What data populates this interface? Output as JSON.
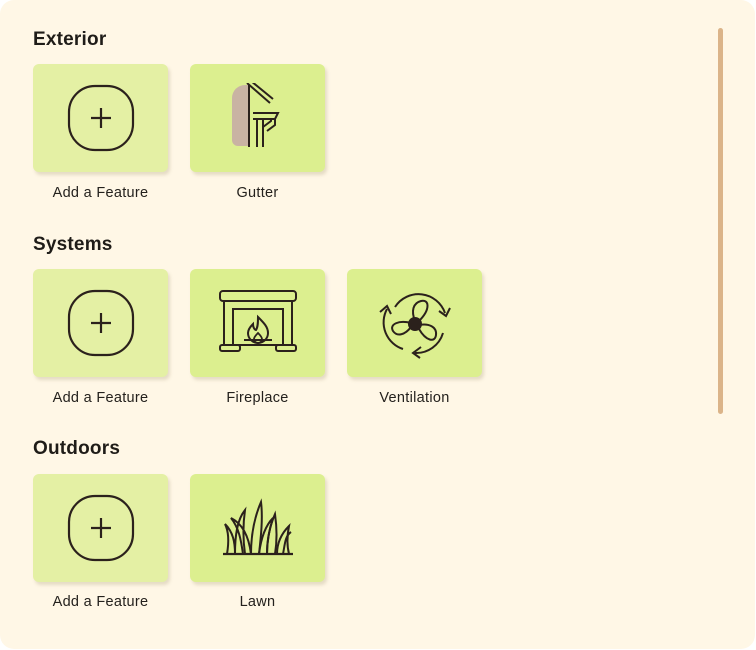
{
  "sections": [
    {
      "title": "Exterior",
      "tiles": [
        {
          "label": "Add a Feature",
          "icon": "plus-circle-icon"
        },
        {
          "label": "Gutter",
          "icon": "gutter-icon"
        }
      ]
    },
    {
      "title": "Systems",
      "tiles": [
        {
          "label": "Add a Feature",
          "icon": "plus-circle-icon"
        },
        {
          "label": "Fireplace",
          "icon": "fireplace-icon"
        },
        {
          "label": "Ventilation",
          "icon": "ventilation-fan-icon"
        }
      ]
    },
    {
      "title": "Outdoors",
      "tiles": [
        {
          "label": "Add a Feature",
          "icon": "plus-circle-icon"
        },
        {
          "label": "Lawn",
          "icon": "lawn-grass-icon"
        }
      ]
    }
  ],
  "colors": {
    "background": "#fff7e6",
    "tile": "#dcef8f",
    "add_tile": "#e4f0a4",
    "icon_stroke": "#2b211c",
    "scrollbar": "#dbb489"
  }
}
